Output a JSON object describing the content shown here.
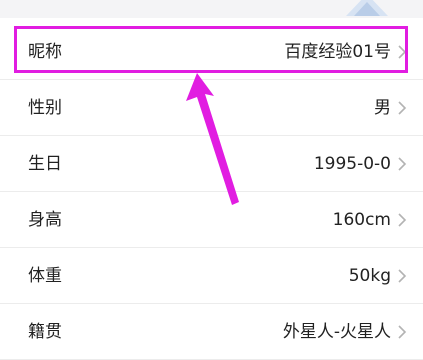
{
  "profile": {
    "rows": [
      {
        "label": "昵称",
        "value": "百度经验01号"
      },
      {
        "label": "性别",
        "value": "男"
      },
      {
        "label": "生日",
        "value": "1995-0-0"
      },
      {
        "label": "身高",
        "value": "160cm"
      },
      {
        "label": "体重",
        "value": "50kg"
      },
      {
        "label": "籍贯",
        "value": "外星人-火星人"
      }
    ]
  },
  "annotation": {
    "color": "#e11de1",
    "highlighted_row": "昵称"
  }
}
